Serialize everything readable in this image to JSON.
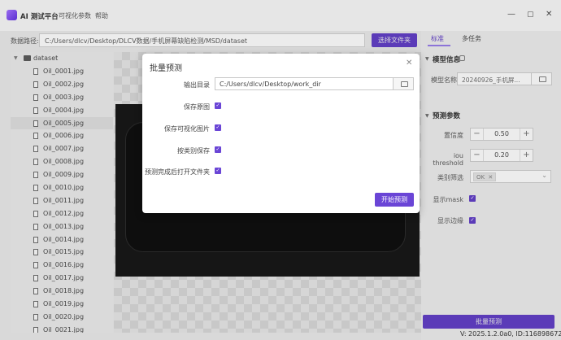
{
  "app": {
    "title": "AI 测试平台",
    "menus": [
      "可视化参数",
      "帮助"
    ],
    "window_controls": {
      "minimize": "—",
      "maximize": "▢",
      "close": "✕"
    }
  },
  "pathbar": {
    "label": "数据路径:",
    "value": "C:/Users/dlcv/Desktop/DLCV数据/手机屏幕缺陷检测/MSD/dataset",
    "browse_label": "选择文件夹"
  },
  "tree": {
    "root": "dataset",
    "selected_index": 4,
    "files": [
      "Oil_0001.jpg",
      "Oil_0002.jpg",
      "Oil_0003.jpg",
      "Oil_0004.jpg",
      "Oil_0005.jpg",
      "Oil_0006.jpg",
      "Oil_0007.jpg",
      "Oil_0008.jpg",
      "Oil_0009.jpg",
      "Oil_0010.jpg",
      "Oil_0011.jpg",
      "Oil_0012.jpg",
      "Oil_0013.jpg",
      "Oil_0014.jpg",
      "Oil_0015.jpg",
      "Oil_0016.jpg",
      "Oil_0017.jpg",
      "Oil_0018.jpg",
      "Oil_0019.jpg",
      "Oil_0020.jpg",
      "Oil_0021.jpg"
    ]
  },
  "right_panel": {
    "tabs": [
      "标准",
      "多任务"
    ],
    "model_info_title": "模型信息",
    "model_name_label": "模型名称",
    "model_name_value": "20240926_手机屏...",
    "predict_params_title": "预测参数",
    "confidence_label": "置信度",
    "confidence_value": "0.50",
    "iou_label": "iou threshold",
    "iou_value": "0.20",
    "class_filter_label": "类别筛选",
    "class_filter_chip": "OK",
    "show_mask_label": "显示mask",
    "show_edge_label": "显示边缘",
    "batch_button": "批量预测",
    "version": "V: 2025.1.2.0a0, ID:1168986726"
  },
  "dialog": {
    "title": "批量预测",
    "output_dir_label": "输出目录",
    "output_dir_value": "C:/Users/dlcv/Desktop/work_dir",
    "options": [
      {
        "label": "保存原图",
        "checked": true
      },
      {
        "label": "保存可视化图片",
        "checked": true
      },
      {
        "label": "按类别保存",
        "checked": true
      },
      {
        "label": "预测完成后打开文件夹",
        "checked": true
      }
    ],
    "start_button": "开始预测",
    "close_glyph": "✕"
  },
  "colors": {
    "accent": "#6a45d6",
    "accent_dim": "#5b3bb8"
  },
  "icons": {
    "checkbox": "✓",
    "stepper_minus": "−",
    "stepper_plus": "+",
    "chip_remove": "✕",
    "chevron": "⌄",
    "caret": "▼"
  }
}
